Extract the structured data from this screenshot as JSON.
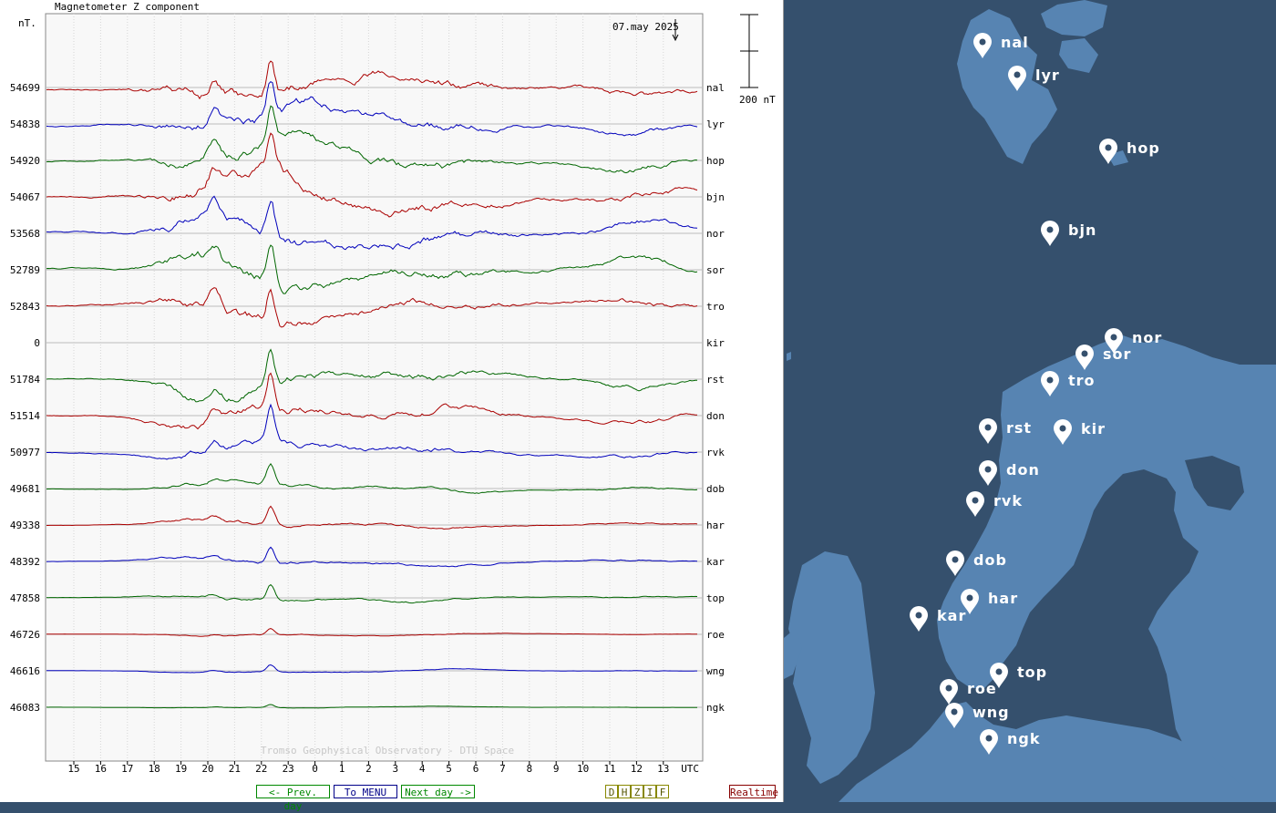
{
  "header": {
    "title": "Magnetometer Z component",
    "units": "nT.",
    "date": "07.may 2025",
    "scale_label": "200 nT",
    "watermark": "Tromso Geophysical Observatory - DTU Space"
  },
  "nav": {
    "prev_day": "<- Prev. day",
    "menu": "To MENU",
    "next_day": "Next day ->",
    "components": [
      "D",
      "H",
      "Z",
      "I",
      "F"
    ],
    "realtime": "Realtime"
  },
  "colors": {
    "red": "#aa0000",
    "blue": "#0000bb",
    "green": "#006600",
    "grid": "#bbbbbb",
    "plot_bg": "#f8f8f8",
    "map_sea": "#35506d",
    "map_land": "#5784b2"
  },
  "chart_data": {
    "type": "line",
    "title": "Magnetometer Z component",
    "ylabel": "nT.",
    "xlabel": "UTC",
    "x_ticks": [
      "15",
      "16",
      "17",
      "18",
      "19",
      "20",
      "21",
      "22",
      "23",
      "0",
      "1",
      "2",
      "3",
      "4",
      "5",
      "6",
      "7",
      "8",
      "9",
      "10",
      "11",
      "12",
      "13",
      "UTC"
    ],
    "x_range_hours": [
      14.3,
      38.0
    ],
    "date": "07.may 2025",
    "scale_bar": "200 nT",
    "grid": true,
    "series": [
      {
        "name": "nal",
        "baseline": "54699",
        "color": "red",
        "activity": 1.0,
        "offset": 0
      },
      {
        "name": "lyr",
        "baseline": "54838",
        "color": "blue",
        "activity": 0.95,
        "offset": 0
      },
      {
        "name": "hop",
        "baseline": "54920",
        "color": "green",
        "activity": 0.95,
        "offset": 0
      },
      {
        "name": "bjn",
        "baseline": "54067",
        "color": "red",
        "activity": 1.05,
        "offset": 0
      },
      {
        "name": "nor",
        "baseline": "53568",
        "color": "blue",
        "activity": 1.0,
        "offset": 0
      },
      {
        "name": "sor",
        "baseline": "52789",
        "color": "green",
        "activity": 0.95,
        "offset": 0
      },
      {
        "name": "tro",
        "baseline": "52843",
        "color": "red",
        "activity": 0.9,
        "offset": 0
      },
      {
        "name": "kir",
        "baseline": "0",
        "color": "blue",
        "activity": 0.0,
        "offset": 0
      },
      {
        "name": "rst",
        "baseline": "51784",
        "color": "green",
        "activity": 0.75,
        "offset": 0
      },
      {
        "name": "don",
        "baseline": "51514",
        "color": "red",
        "activity": 0.7,
        "offset": 0
      },
      {
        "name": "rvk",
        "baseline": "50977",
        "color": "blue",
        "activity": 0.55,
        "offset": 0
      },
      {
        "name": "dob",
        "baseline": "49681",
        "color": "green",
        "activity": 0.3,
        "offset": 0
      },
      {
        "name": "har",
        "baseline": "49338",
        "color": "red",
        "activity": 0.28,
        "offset": 0
      },
      {
        "name": "kar",
        "baseline": "48392",
        "color": "blue",
        "activity": 0.25,
        "offset": 0
      },
      {
        "name": "top",
        "baseline": "47858",
        "color": "green",
        "activity": 0.22,
        "offset": 0
      },
      {
        "name": "roe",
        "baseline": "46726",
        "color": "red",
        "activity": 0.1,
        "offset": 0
      },
      {
        "name": "wng",
        "baseline": "46616",
        "color": "blue",
        "activity": 0.1,
        "offset": 0
      },
      {
        "name": "ngk",
        "baseline": "46083",
        "color": "green",
        "activity": 0.05,
        "offset": 0
      }
    ]
  },
  "map": {
    "stations": [
      "nal",
      "lyr",
      "hop",
      "bjn",
      "nor",
      "sor",
      "tro",
      "rst",
      "kir",
      "don",
      "rvk",
      "dob",
      "har",
      "kar",
      "top",
      "roe",
      "wng",
      "ngk"
    ]
  }
}
